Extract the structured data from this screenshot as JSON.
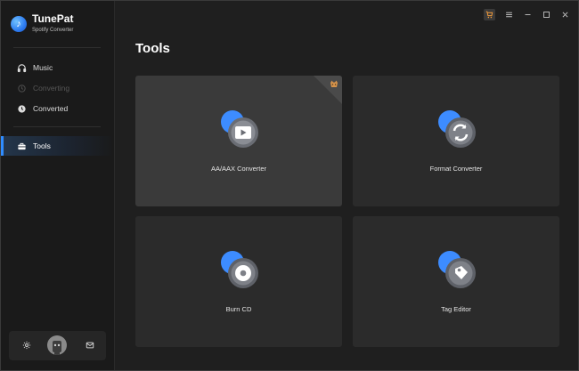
{
  "app": {
    "name": "TunePat",
    "subtitle": "Spotify Converter"
  },
  "sidebar": {
    "items": [
      {
        "label": "Music",
        "icon": "headphones-icon",
        "state": "normal"
      },
      {
        "label": "Converting",
        "icon": "converting-icon",
        "state": "disabled"
      },
      {
        "label": "Converted",
        "icon": "clock-icon",
        "state": "normal"
      },
      {
        "label": "Tools",
        "icon": "toolbox-icon",
        "state": "active"
      }
    ],
    "bottom": {
      "settings_icon": "gear-icon",
      "avatar": "avatar",
      "mail_icon": "mail-icon"
    }
  },
  "titlebar": {
    "icons": [
      "cart-icon",
      "menu-icon",
      "minimize-icon",
      "maximize-icon",
      "close-icon"
    ]
  },
  "main": {
    "title": "Tools",
    "tools": [
      {
        "label": "AA/AAX Converter",
        "icon": "audiobook-icon",
        "badge": "premium-badge-icon"
      },
      {
        "label": "Format Converter",
        "icon": "refresh-icon"
      },
      {
        "label": "Burn CD",
        "icon": "disc-icon"
      },
      {
        "label": "Tag Editor",
        "icon": "tag-icon"
      }
    ]
  },
  "colors": {
    "accent": "#2f8cff",
    "background": "#1f1f1f",
    "card": "#2b2b2b",
    "card_hover": "#3a3a3a"
  }
}
